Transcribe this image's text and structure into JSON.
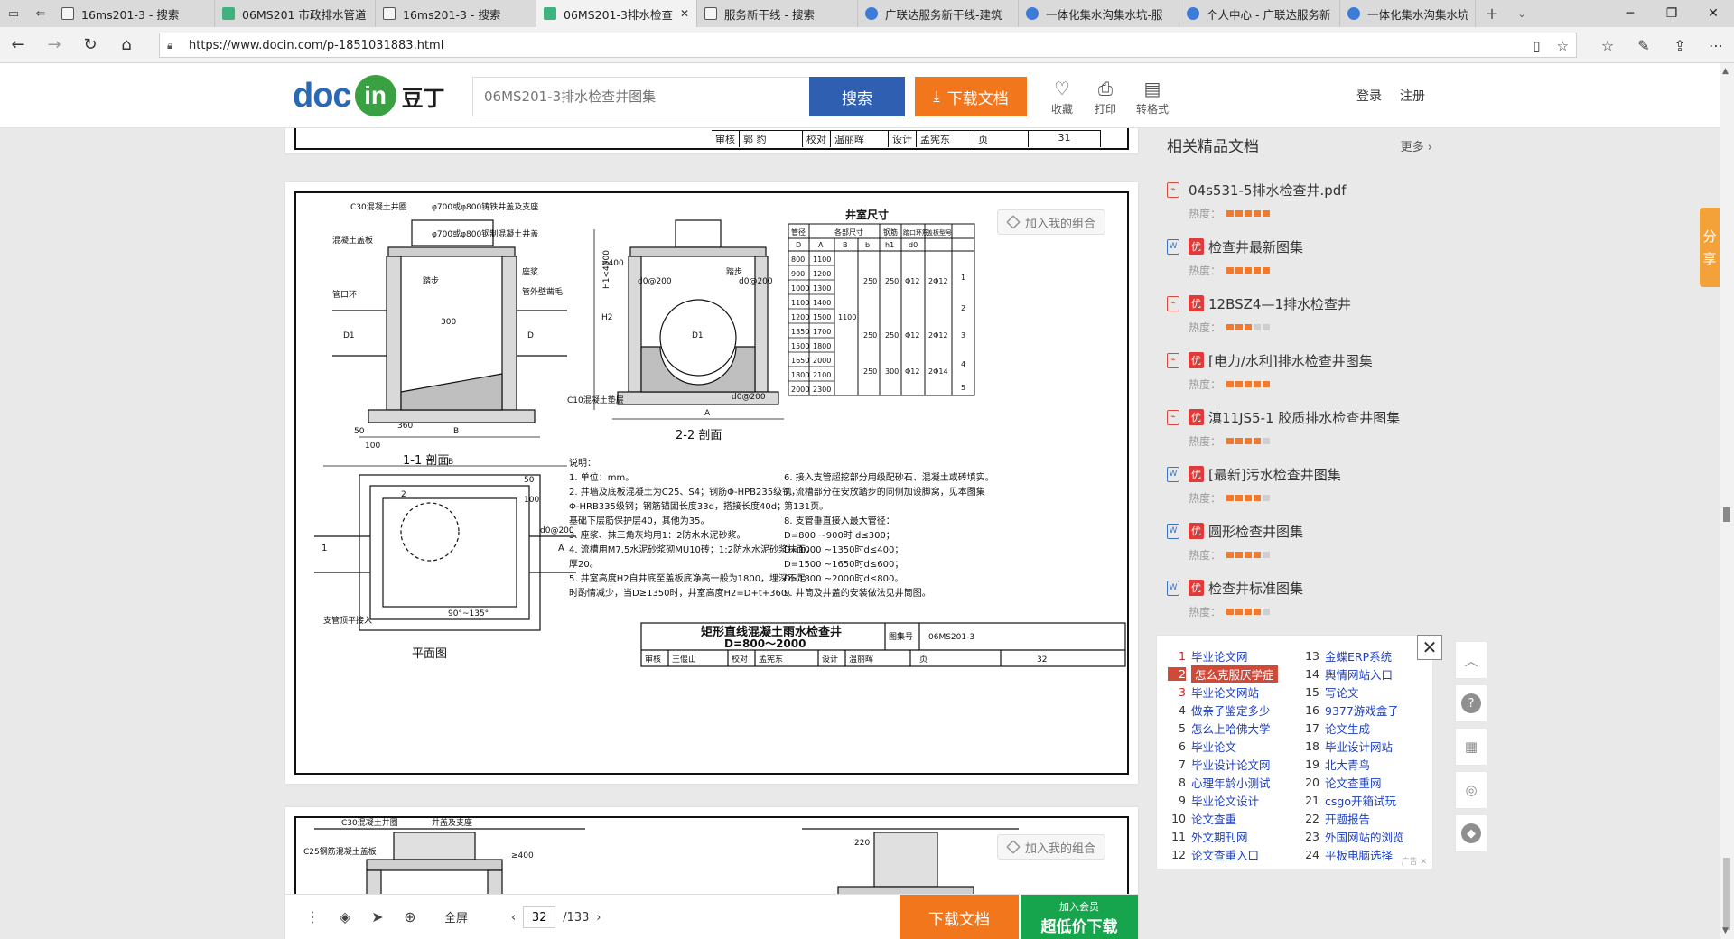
{
  "browser": {
    "tabs": [
      {
        "label": "16ms201-3 - 搜索",
        "icon": "page-icon",
        "active": false
      },
      {
        "label": "06MS201 市政排水管道",
        "icon": "green-icon",
        "active": false
      },
      {
        "label": "16ms201-3 - 搜索",
        "icon": "page-icon",
        "active": false
      },
      {
        "label": "06MS201-3排水检查",
        "icon": "green-icon",
        "active": true
      },
      {
        "label": "服务新干线 - 搜索",
        "icon": "page-icon",
        "active": false
      },
      {
        "label": "广联达服务新干线-建筑",
        "icon": "blue-icon",
        "active": false
      },
      {
        "label": "一体化集水沟集水坑-服",
        "icon": "blue-icon",
        "active": false
      },
      {
        "label": "个人中心 - 广联达服务新",
        "icon": "blue-icon",
        "active": false
      },
      {
        "label": "一体化集水沟集水坑-服",
        "icon": "blue-icon",
        "active": false
      }
    ],
    "url": "https://www.docin.com/p-1851031883.html"
  },
  "header": {
    "logo_doc": "doc",
    "logo_in": "in",
    "logo_zh": "豆丁",
    "search_placeholder": "06MS201-3排水检查井图集",
    "search_button": "搜索",
    "download_button": "下载文档",
    "tools": [
      {
        "label": "收藏",
        "icon": "heart-icon"
      },
      {
        "label": "打印",
        "icon": "printer-icon"
      },
      {
        "label": "转格式",
        "icon": "convert-icon"
      }
    ],
    "login": "登录",
    "register": "注册"
  },
  "document": {
    "add_combo": "加入我的组合",
    "prev_page_titleblock": [
      "审核",
      "郭 豹",
      "校对",
      "温丽晖",
      "设计",
      "孟宪东",
      "页",
      "31"
    ],
    "drawing": {
      "section_1": "1-1 剖面",
      "section_2": "2-2 剖面",
      "plan": "平面图",
      "table_title": "井室尺寸",
      "table_headers": [
        "管径",
        "各部尺寸",
        "",
        "",
        "",
        "钢筋",
        "踏口环筋",
        "盖板型号"
      ],
      "table_subheaders": [
        "D",
        "A",
        "B",
        "b",
        "h1",
        "d0",
        "",
        ""
      ],
      "table_rows": [
        [
          "800",
          "1100"
        ],
        [
          "900",
          "1200"
        ],
        [
          "1000",
          "1300"
        ],
        [
          "1100",
          "1400"
        ],
        [
          "1200",
          "1500"
        ],
        [
          "1350",
          "1700"
        ],
        [
          "1500",
          "1800"
        ],
        [
          "1650",
          "2000"
        ],
        [
          "1800",
          "2100"
        ],
        [
          "2000",
          "2300"
        ]
      ],
      "table_common_B": "1100",
      "table_groups": [
        {
          "b": "250",
          "h1": "250",
          "d0": "Φ12",
          "ring": "2Φ12"
        },
        {
          "b": "250",
          "h1": "250",
          "d0": "Φ12",
          "ring": "2Φ12"
        },
        {
          "b": "250",
          "h1": "300",
          "d0": "Φ12",
          "ring": "2Φ14"
        }
      ],
      "table_cover_types": [
        "1",
        "2",
        "3",
        "4",
        "5"
      ],
      "labels": {
        "cover": "C30混凝土井圈",
        "frame": "φ700或φ800铸铁井盖及支座",
        "frame2": "φ700或φ800钢制混凝土井盖",
        "slab": "混凝土盖板",
        "pipe": "管口环",
        "stair": "踏步",
        "floor": "座浆",
        "pipe_end": "管外壁凿毛",
        "c10": "C10混凝土垫层",
        "branch": "支管顶平接入",
        "angle": "90°~135°",
        "h2": "H2",
        "h1": "H1<4000",
        "d1": "D1",
        "d": "D",
        "a": "A",
        "b_cap": "B",
        "b_small": "b",
        "d0_200": "d0@200",
        "dim_400": "≥400",
        "dim_360": "360",
        "dim_300": "300",
        "dim_50": "50",
        "dim_100": "100"
      },
      "notes_title": "说明：",
      "notes_left": [
        "1. 单位：mm。",
        "2. 井墙及底板混凝土为C25、S4；钢筋Φ-HPB235级钢，",
        "Φ-HRB335级钢；钢筋锚固长度33d，搭接长度40d；",
        "基础下层筋保护层40，其他为35。",
        "3. 座浆、抹三角灰均用1：2防水水泥砂浆。",
        "4. 流槽用M7.5水泥砂浆砌MU10砖；1:2防水水泥砂浆抹面，",
        "厚20。",
        "5. 井室高度H2自井底至盖板底净高一般为1800，埋深不足",
        "时酌情减少，当D≥1350时，井室高度H2=D+t+360。"
      ],
      "notes_right": [
        "6. 接入支管超挖部分用级配砂石、混凝土或砖填实。",
        "7. 流槽部分在安放踏步的同侧加设脚窝，见本图集",
        "第131页。",
        "8. 支管垂直接入最大管径：",
        "D=800 ~900时  d≤300；",
        "D=1000 ~1350时d≤400；",
        "D=1500 ~1650时d≤600；",
        "D=1800 ~2000时d≤800。",
        "9. 井筒及井盖的安装做法见井筒图。"
      ],
      "title_main": "矩形直线混凝土雨水检查井",
      "title_sub": "D=800～2000",
      "atlas_label": "图集号",
      "atlas_no": "06MS201-3",
      "titleblock": [
        "审核",
        "王偃山",
        "校对",
        "孟宪东",
        "设计",
        "温丽晖",
        "页",
        "32"
      ]
    },
    "next_page_labels": [
      "C30混凝土井圈",
      "井盖及支座",
      "C25钢筋混凝土盖板",
      "≥400",
      "220"
    ]
  },
  "sidebar": {
    "related_title": "相关精品文档",
    "more": "更多",
    "heat_label": "热度：",
    "items": [
      {
        "badge": "",
        "name": "04s531-5排水检查井.pdf",
        "type": "pdf",
        "heat": 5
      },
      {
        "badge": "优",
        "name": "检查井最新图集",
        "type": "word",
        "heat": 5
      },
      {
        "badge": "优",
        "name": "12BSZ4—1排水检查井",
        "type": "pdf",
        "heat": 3
      },
      {
        "badge": "优",
        "name": "[电力/水利]排水检查井图集",
        "type": "pdf",
        "heat": 5
      },
      {
        "badge": "优",
        "name": "滇11JS5-1 胶质排水检查井图集",
        "type": "pdf",
        "heat": 4
      },
      {
        "badge": "优",
        "name": "[最新]污水检查井图集",
        "type": "word",
        "heat": 4
      },
      {
        "badge": "优",
        "name": "圆形检查井图集",
        "type": "word",
        "heat": 4
      },
      {
        "badge": "优",
        "name": "检查井标准图集",
        "type": "word",
        "heat": 4
      }
    ],
    "ad_left": [
      {
        "n": "1",
        "t": "毕业论文网"
      },
      {
        "n": "2",
        "t": "怎么克服厌学症"
      },
      {
        "n": "3",
        "t": "毕业论文网站"
      },
      {
        "n": "4",
        "t": "做亲子鉴定多少"
      },
      {
        "n": "5",
        "t": "怎么上哈佛大学"
      },
      {
        "n": "6",
        "t": "毕业论文"
      },
      {
        "n": "7",
        "t": "毕业设计论文网"
      },
      {
        "n": "8",
        "t": "心理年龄小测试"
      },
      {
        "n": "9",
        "t": "毕业论文设计"
      },
      {
        "n": "10",
        "t": "论文查重"
      },
      {
        "n": "11",
        "t": "外文期刊网"
      },
      {
        "n": "12",
        "t": "论文查重入口"
      }
    ],
    "ad_right": [
      {
        "n": "13",
        "t": "金蝶ERP系统"
      },
      {
        "n": "14",
        "t": "舆情网站入口"
      },
      {
        "n": "15",
        "t": "写论文"
      },
      {
        "n": "16",
        "t": "9377游戏盒子"
      },
      {
        "n": "17",
        "t": "论文生成"
      },
      {
        "n": "18",
        "t": "毕业设计网站"
      },
      {
        "n": "19",
        "t": "北大青鸟"
      },
      {
        "n": "20",
        "t": "论文查重网"
      },
      {
        "n": "21",
        "t": "csgo开箱试玩"
      },
      {
        "n": "22",
        "t": "开题报告"
      },
      {
        "n": "23",
        "t": "外国网站的浏览"
      },
      {
        "n": "24",
        "t": "平板电脑选择"
      }
    ],
    "ad_label": "广告",
    "share": [
      "分",
      "享"
    ],
    "float_tools": [
      "chevron-up-icon",
      "help-icon",
      "qrcode-icon",
      "wechat-icon",
      "qq-icon"
    ]
  },
  "bottom_bar": {
    "fullscreen": "全屏",
    "current_page": "32",
    "total_pages": "/133",
    "download": "下载文档",
    "vip_small": "加入会员",
    "vip_big": "超低价下载"
  },
  "colors": {
    "brand_blue": "#2f5fb1",
    "brand_orange": "#f2761b",
    "brand_green": "#16a54c",
    "badge_red": "#e03b3b",
    "heat_orange": "#f07a2e"
  }
}
